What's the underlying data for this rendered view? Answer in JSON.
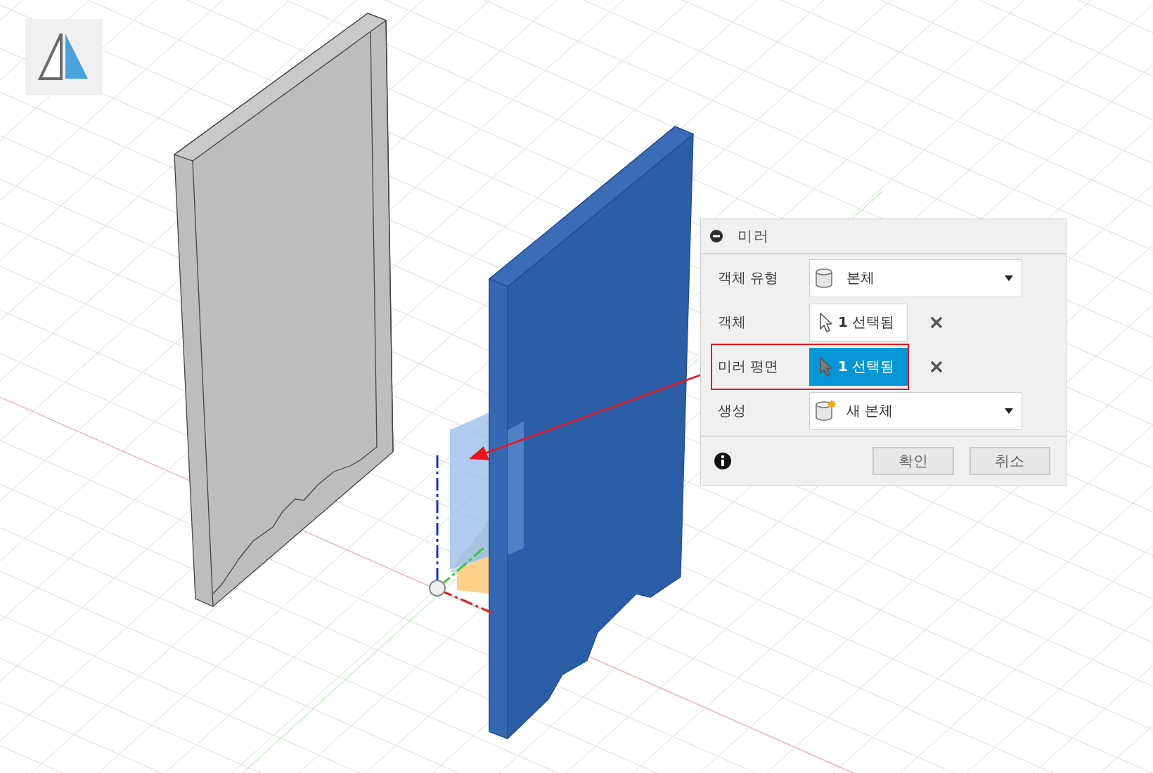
{
  "dialog": {
    "title": "미러",
    "rows": [
      {
        "kind": "dropdown",
        "label": "객체 유형",
        "value": "본체",
        "highlighted": false
      },
      {
        "kind": "selection",
        "label": "객체",
        "value": "**1** 선택됨",
        "selected": false,
        "highlighted": false
      },
      {
        "kind": "selection",
        "label": "미러 평면",
        "value": "**1** 선택됨",
        "selected": true,
        "highlighted": true
      },
      {
        "kind": "dropdown",
        "label": "생성",
        "value": "새 본체",
        "highlighted": false
      }
    ],
    "buttons": [
      {
        "label": "확인"
      },
      {
        "label": "취소"
      }
    ]
  }
}
